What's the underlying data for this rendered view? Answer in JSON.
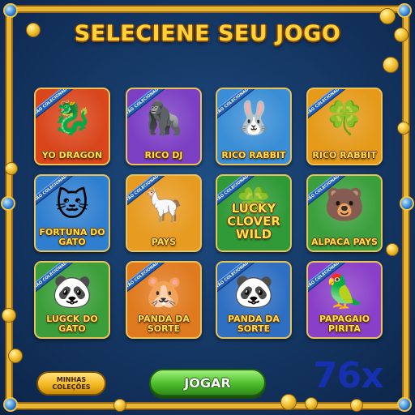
{
  "title": "SELECIENE SEU JOGO",
  "ribbon_text": "ARTÃO COLECIONADOR",
  "cards": [
    {
      "label": "YO DRAGON",
      "icon": "dragon-icon",
      "bg": "#d9461c"
    },
    {
      "label": "RICO DJ",
      "icon": "gorilla-dj-icon",
      "bg": "#7b3fc4"
    },
    {
      "label": "RICO RABBIT",
      "icon": "rabbit-icon",
      "bg": "#3a8ed6"
    },
    {
      "label": "RICO RABBIT",
      "icon": "clover-icon",
      "bg": "#e59a1a"
    },
    {
      "label": "FORTUNA DO GATO",
      "icon": "cat-icon",
      "bg": "#2f7fd0"
    },
    {
      "label": "PAYS",
      "icon": "alpaca-icon",
      "bg": "#e79b21"
    },
    {
      "label": "LUCKY CLOVER WILD",
      "icon": "clover-icon",
      "bg": "#2f9a37"
    },
    {
      "label": "ALPACA PAYS",
      "icon": "bear-icon",
      "bg": "#3a9f3c"
    },
    {
      "label": "LUGCK DO GATO",
      "icon": "panda-icon",
      "bg": "#3b9e3a"
    },
    {
      "label": "PANDA DA SORTE",
      "icon": "capybara-icon",
      "bg": "#e07a1e"
    },
    {
      "label": "PANDA DA SORTE",
      "icon": "pirate-panda-icon",
      "bg": "#2f6fc2"
    },
    {
      "label": "PAPAGAIO PIRITA",
      "icon": "parrot-icon",
      "bg": "#8a3fc8"
    }
  ],
  "buttons": {
    "collections_line1": "MINHAS",
    "collections_line2": "COLEÇÕES",
    "play": "JOGAR"
  },
  "multiplier": "76x",
  "colors": {
    "title": "#ffd23a",
    "frame_gold": "#e8b636",
    "play_green": "#4dbd2d",
    "multiplier_blue": "#1630b0"
  }
}
